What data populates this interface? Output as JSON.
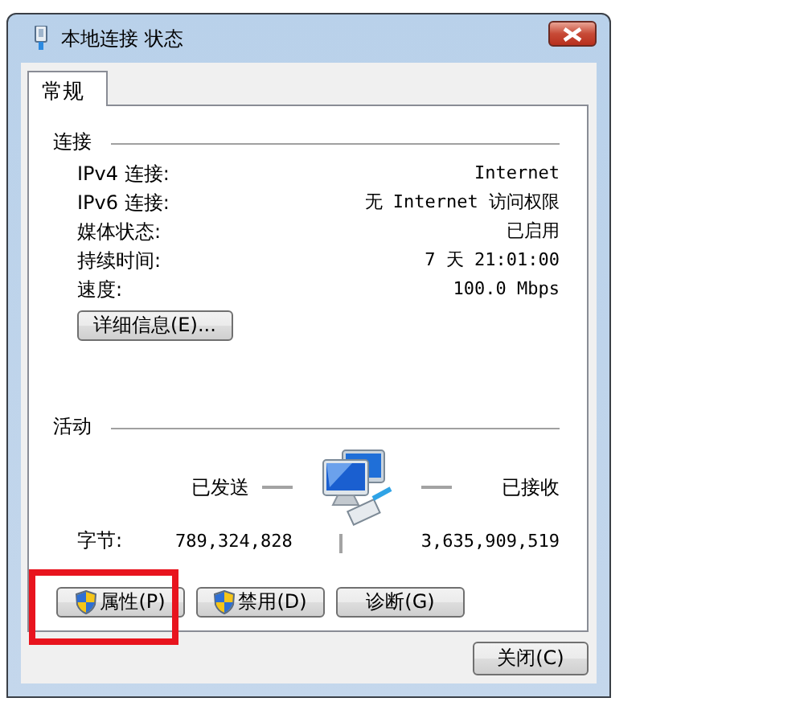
{
  "window": {
    "title": "本地连接 状态"
  },
  "tabs": [
    {
      "label": "常规",
      "selected": true
    }
  ],
  "connection": {
    "heading": "连接",
    "rows": [
      {
        "label": "IPv4 连接:",
        "value": "Internet"
      },
      {
        "label": "IPv6 连接:",
        "value": "无 Internet 访问权限"
      },
      {
        "label": "媒体状态:",
        "value": "已启用"
      },
      {
        "label": "持续时间:",
        "value": "7 天 21:01:00"
      },
      {
        "label": "速度:",
        "value": "100.0 Mbps"
      }
    ]
  },
  "details_button": "详细信息(E)...",
  "activity": {
    "heading": "活动",
    "sent_label": "已发送",
    "received_label": "已接收",
    "bytes_label": "字节:",
    "bytes_sent": "789,324,828",
    "bytes_received": "3,635,909,519"
  },
  "buttons": [
    {
      "label": "属性(P)",
      "shield": true,
      "highlighted": true
    },
    {
      "label": "禁用(D)",
      "shield": true,
      "highlighted": false
    },
    {
      "label": "诊断(G)",
      "shield": false,
      "highlighted": false
    }
  ],
  "close_button": "关闭(C)"
}
